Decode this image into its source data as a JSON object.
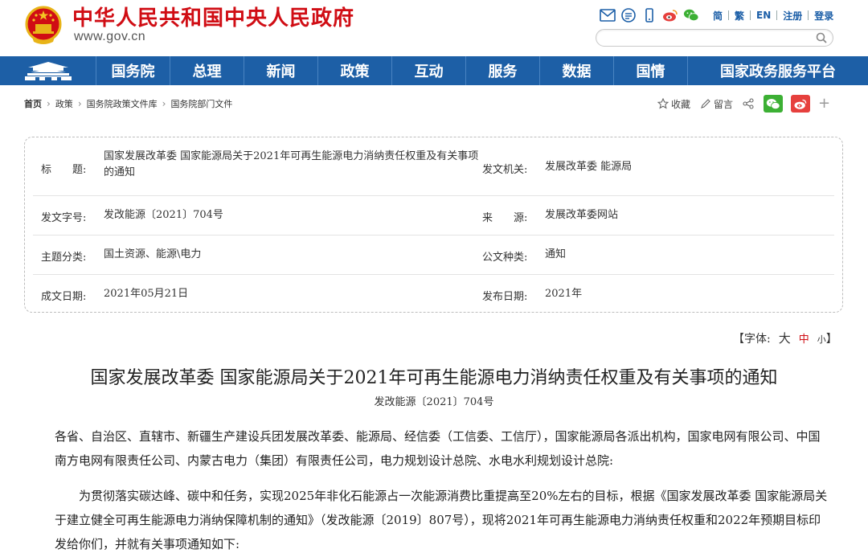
{
  "header": {
    "site_title": "中华人民共和国中央人民政府",
    "site_domain": "www.gov.cn",
    "top_links": [
      "简",
      "繁",
      "EN",
      "注册",
      "登录"
    ],
    "search": {
      "placeholder": ""
    },
    "colors": {
      "brand_red": "#d00d14",
      "nav_blue": "#1d5fa6",
      "wechat_green": "#3cb034",
      "weibo_red": "#e6403d"
    },
    "tool_icons": [
      "mail-icon",
      "chat-icon",
      "mobile-icon",
      "weibo-icon",
      "wechat-icon"
    ]
  },
  "nav": {
    "items": [
      {
        "label": "国务院"
      },
      {
        "label": "总理"
      },
      {
        "label": "新闻"
      },
      {
        "label": "政策"
      },
      {
        "label": "互动"
      },
      {
        "label": "服务"
      },
      {
        "label": "数据"
      },
      {
        "label": "国情"
      },
      {
        "label": "国家政务服务平台"
      }
    ]
  },
  "breadcrumb": [
    "首页",
    "政策",
    "国务院政策文件库",
    "国务院部门文件"
  ],
  "share": {
    "favorite": "收藏",
    "comment": "留言"
  },
  "info": {
    "title_label": "标　　题:",
    "title_value": "国家发展改革委 国家能源局关于2021年可再生能源电力消纳责任权重及有关事项的通知",
    "issuer_label": "发文机关:",
    "issuer_value": "发展改革委 能源局",
    "docno_label": "发文字号:",
    "docno_value": "发改能源〔2021〕704号",
    "source_label": "来　　源:",
    "source_value": "发展改革委网站",
    "topic_label": "主题分类:",
    "topic_value": "国土资源、能源\\电力",
    "type_label": "公文种类:",
    "type_value": "通知",
    "written_label": "成文日期:",
    "written_value": "2021年05月21日",
    "published_label": "发布日期:",
    "published_value": "2021年"
  },
  "font_size": {
    "label": "【字体:",
    "big": "大",
    "medium": "中",
    "small": "小",
    "close": "】"
  },
  "article": {
    "title": "国家发展改革委 国家能源局关于2021年可再生能源电力消纳责任权重及有关事项的通知",
    "doc_number": "发改能源〔2021〕704号",
    "para1": "各省、自治区、直辖市、新疆生产建设兵团发展改革委、能源局、经信委（工信委、工信厅），国家能源局各派出机构，国家电网有限公司、中国南方电网有限责任公司、内蒙古电力（集团）有限责任公司，电力规划设计总院、水电水利规划设计总院:",
    "para2": "为贯彻落实碳达峰、碳中和任务，实现2025年非化石能源占一次能源消费比重提高至20%左右的目标，根据《国家发展改革委 国家能源局关于建立健全可再生能源电力消纳保障机制的通知》（发改能源〔2019〕807号），现将2021年可再生能源电力消纳责任权重和2022年预期目标印发给你们，并就有关事项通知如下:"
  }
}
